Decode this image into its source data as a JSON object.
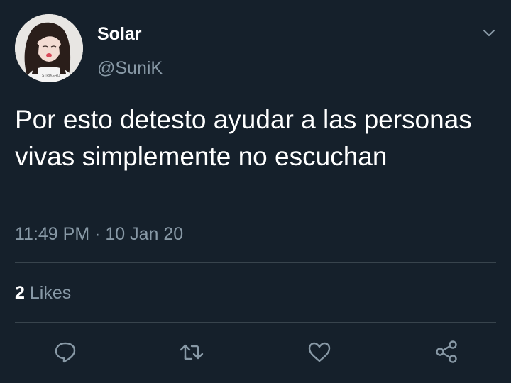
{
  "user": {
    "display_name": "Solar",
    "handle": "@SuniK",
    "avatar_shirt_text": "STRIKERO"
  },
  "tweet": {
    "text": "Por esto detesto ayudar a las personas vivas simplemente no escuchan",
    "timestamp": "11:49 PM · 10 Jan 20"
  },
  "stats": {
    "likes_count": "2",
    "likes_label": "Likes"
  },
  "actions": {
    "icons": [
      "reply-icon",
      "retweet-icon",
      "like-icon",
      "share-icon"
    ]
  },
  "colors": {
    "background": "#15202b",
    "primary_text": "#ffffff",
    "secondary_text": "#8899a6",
    "divider": "#38444d",
    "icon": "#8899a6"
  }
}
